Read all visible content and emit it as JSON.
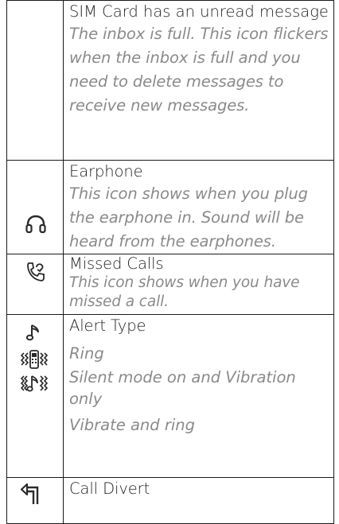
{
  "rows": [
    {
      "title": "SIM Card has an unread message",
      "description": "The inbox is full. This icon flickers when the inbox is full and you need to delete messages to receive new messages."
    },
    {
      "icon": "headphones-icon",
      "title": "Earphone",
      "description": "This icon shows when you plug the earphone in. Sound will be heard from the earphones."
    },
    {
      "icon": "missed-call-phone-icon",
      "title": "Missed Calls",
      "description": "This icon shows when you have missed a call."
    },
    {
      "icons": [
        "music-note-icon",
        "vibrate-icon",
        "vibrate-ring-icon"
      ],
      "title": "Alert Type",
      "items": [
        "Ring",
        "Silent mode on and Vibration only",
        "Vibrate and ring"
      ]
    },
    {
      "icon": "call-divert-arrow-icon",
      "title": "Call Divert"
    }
  ]
}
